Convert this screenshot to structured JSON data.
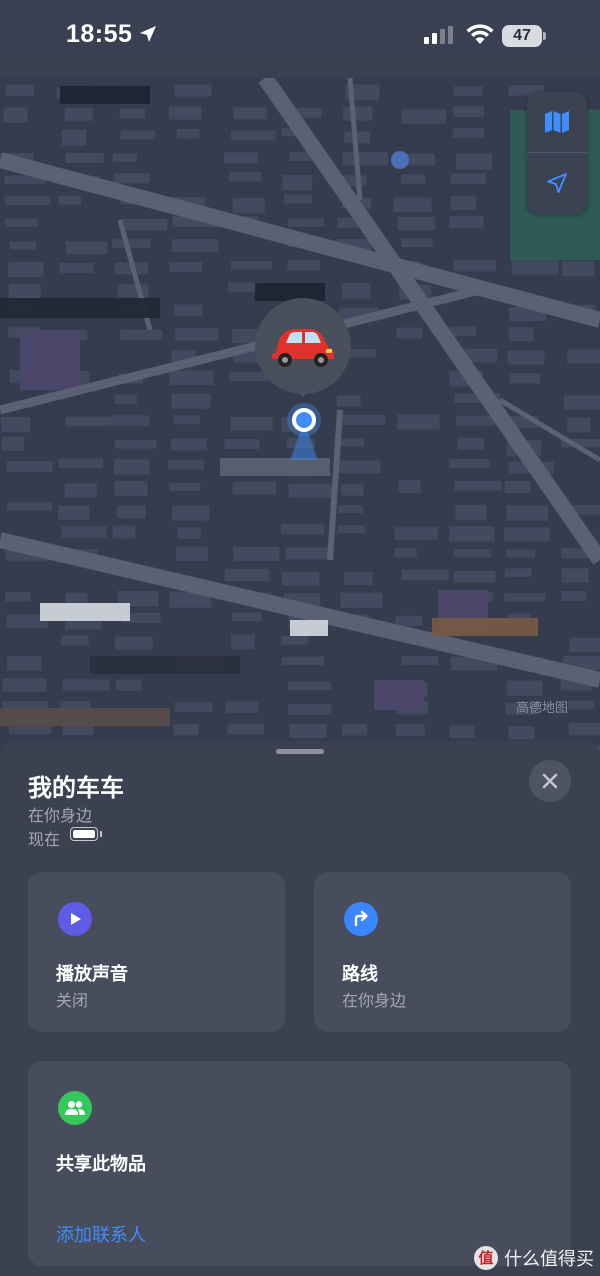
{
  "status_bar": {
    "time": "18:55",
    "battery": "47"
  },
  "map": {
    "attribution": "高德地图",
    "pin_glyph": "🚗"
  },
  "sheet": {
    "item_name": "我的车车",
    "location_text": "在你身边",
    "time_text": "现在",
    "cards": {
      "play_sound": {
        "title": "播放声音",
        "subtitle": "关闭",
        "icon": "play-icon",
        "color": "#5e5ce6"
      },
      "directions": {
        "title": "路线",
        "subtitle": "在你身边",
        "icon": "turn-right-arrow-icon",
        "color": "#3a86ff"
      },
      "share": {
        "title": "共享此物品",
        "link": "添加联系人",
        "icon": "people-icon",
        "color": "#34c759"
      }
    }
  },
  "watermark": {
    "text": "什么值得买",
    "logo": "值"
  },
  "colors": {
    "accent": "#3f8dff",
    "sheet_bg": "#3b4150",
    "card_bg": "#474d5c",
    "map_bg": "#353c4d"
  }
}
